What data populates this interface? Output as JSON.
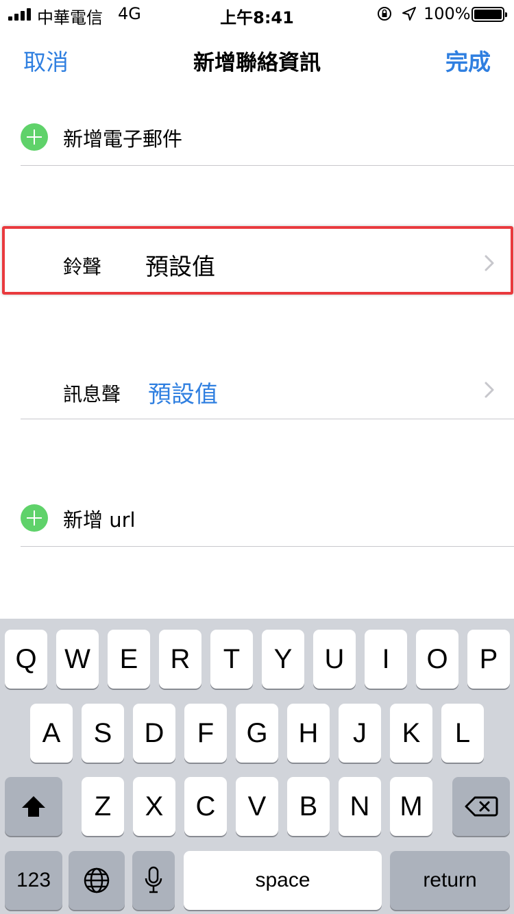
{
  "status": {
    "carrier": "中華電信",
    "network": "4G",
    "time": "上午8:41",
    "battery": "100%",
    "battery_level": 1.0
  },
  "nav": {
    "cancel": "取消",
    "title": "新增聯絡資訊",
    "done": "完成"
  },
  "rows": {
    "add_email": "新增電子郵件",
    "ringtone_label": "鈴聲",
    "ringtone_value": "預設值",
    "text_tone_label": "訊息聲",
    "text_tone_value": "預設值",
    "add_url": "新增 url"
  },
  "colors": {
    "accent": "#2f7fe0",
    "add_green": "#5fd26a",
    "highlight_red": "#e93a3e"
  },
  "keyboard": {
    "row1": [
      "Q",
      "W",
      "E",
      "R",
      "T",
      "Y",
      "U",
      "I",
      "O",
      "P"
    ],
    "row2": [
      "A",
      "S",
      "D",
      "F",
      "G",
      "H",
      "J",
      "K",
      "L"
    ],
    "row3": [
      "Z",
      "X",
      "C",
      "V",
      "B",
      "N",
      "M"
    ],
    "numbers": "123",
    "space": "space",
    "return": "return",
    "icons": [
      "shift-icon",
      "backspace-icon",
      "globe-icon",
      "microphone-icon"
    ]
  }
}
